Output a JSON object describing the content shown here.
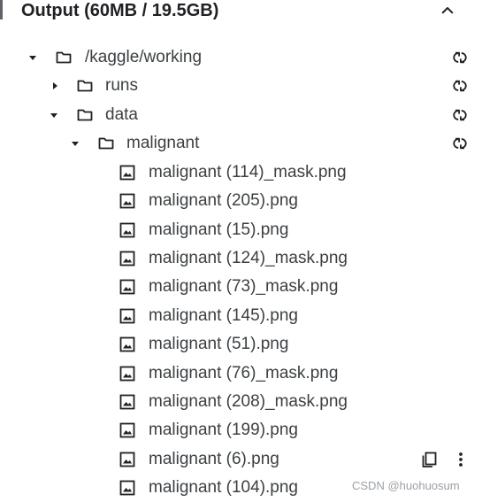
{
  "header": {
    "title": "Output (60MB / 19.5GB)"
  },
  "tree": {
    "root": {
      "label": "/kaggle/working",
      "expanded": true
    },
    "runs": {
      "label": "runs",
      "expanded": false
    },
    "data": {
      "label": "data",
      "expanded": true
    },
    "malignant": {
      "label": "malignant",
      "expanded": true
    },
    "files": [
      "malignant (114)_mask.png",
      "malignant (205).png",
      "malignant (15).png",
      "malignant (124)_mask.png",
      "malignant (73)_mask.png",
      "malignant (145).png",
      "malignant (51).png",
      "malignant (76)_mask.png",
      "malignant (208)_mask.png",
      "malignant (199).png",
      "malignant (6).png",
      "malignant (104).png"
    ]
  },
  "watermark": "CSDN @huohuosum",
  "icons": {
    "collapse": "chevron-up-icon",
    "caret_open": "caret-down-icon",
    "caret_closed": "caret-right-icon",
    "folder": "folder-icon",
    "image": "image-file-icon",
    "refresh": "refresh-icon",
    "copy": "copy-icon",
    "more": "more-vert-icon"
  },
  "colors": {
    "text": "#3c4043",
    "title": "#202124",
    "icon": "#202124",
    "watermark": "#9aa0a6"
  }
}
